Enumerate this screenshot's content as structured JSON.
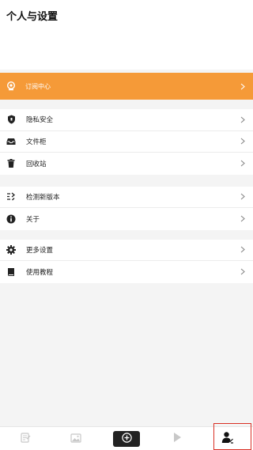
{
  "header": {
    "title": "个人与设置"
  },
  "subscribe": {
    "label": "订阅中心",
    "color": "#f59a38",
    "icon": "subscription-icon"
  },
  "groups": [
    {
      "items": [
        {
          "label": "隐私安全",
          "icon": "shield-icon"
        },
        {
          "label": "文件柜",
          "icon": "tray-icon"
        },
        {
          "label": "回收站",
          "icon": "trash-icon"
        }
      ]
    },
    {
      "items": [
        {
          "label": "检测新版本",
          "icon": "update-icon"
        },
        {
          "label": "关于",
          "icon": "info-icon"
        }
      ]
    },
    {
      "items": [
        {
          "label": "更多设置",
          "icon": "gear-icon"
        },
        {
          "label": "使用教程",
          "icon": "book-icon"
        }
      ]
    }
  ],
  "tabbar": {
    "tabs": [
      {
        "icon": "note-icon"
      },
      {
        "icon": "image-icon"
      },
      {
        "icon": "add-icon"
      },
      {
        "icon": "play-icon"
      },
      {
        "icon": "profile-icon"
      }
    ],
    "active_color": "#d93025"
  }
}
